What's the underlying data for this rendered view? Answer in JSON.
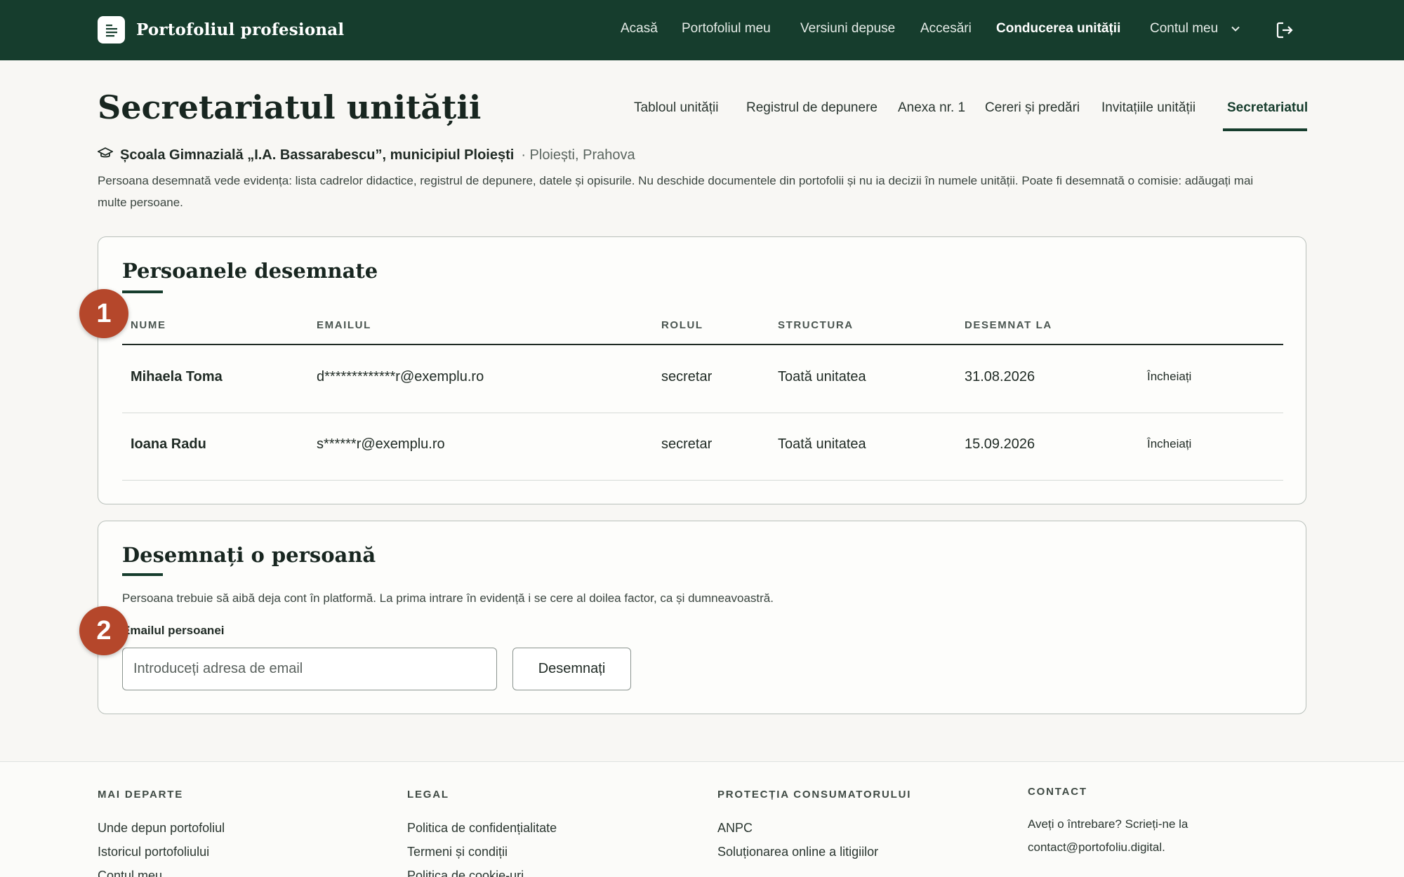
{
  "header": {
    "brand": "Portofoliul profesional",
    "nav": [
      "Acasă",
      "Portofoliul meu",
      "Versiuni depuse",
      "Accesări",
      "Conducerea unității"
    ],
    "account": "Contul meu"
  },
  "page": {
    "title": "Secretariatul unității",
    "tabs": [
      "Tabloul unității",
      "Registrul de depunere",
      "Anexa nr. 1",
      "Cereri și predări",
      "Invitațiile unității",
      "Secretariatul"
    ],
    "active_tab": "Secretariatul",
    "school_name": "Școala Gimnazială „I.A. Bassarabescu”, municipiul Ploiești",
    "school_location": "· Ploiești, Prahova",
    "intro": "Persoana desemnată vede evidența: lista cadrelor didactice, registrul de depunere, datele și opisurile. Nu deschide documentele din portofolii și nu ia decizii în numele unității. Poate fi desemnată o comisie: adăugați mai multe persoane."
  },
  "designated": {
    "title": "Persoanele desemnate",
    "columns": [
      "NUME",
      "EMAILUL",
      "ROLUL",
      "STRUCTURA",
      "DESEMNAT LA"
    ],
    "rows": [
      {
        "name": "Mihaela Toma",
        "email": "d*************r@exemplu.ro",
        "role": "secretar",
        "structure": "Toată unitatea",
        "date": "31.08.2026",
        "action": "Încheiați"
      },
      {
        "name": "Ioana Radu",
        "email": "s******r@exemplu.ro",
        "role": "secretar",
        "structure": "Toată unitatea",
        "date": "15.09.2026",
        "action": "Încheiați"
      }
    ]
  },
  "designate_form": {
    "title": "Desemnați o persoană",
    "note": "Persoana trebuie să aibă deja cont în platformă. La prima intrare în evidență i se cere al doilea factor, ca și dumneavoastră.",
    "label": "Emailul persoanei",
    "placeholder": "Introduceți adresa de email",
    "button": "Desemnați"
  },
  "badges": [
    "1",
    "2"
  ],
  "footer": {
    "col1": {
      "title": "MAI DEPARTE",
      "links": [
        "Unde depun portofoliul",
        "Istoricul portofoliului",
        "Contul meu"
      ]
    },
    "col2": {
      "title": "LEGAL",
      "links": [
        "Politica de confidențialitate",
        "Termeni și condiții",
        "Politica de cookie-uri"
      ]
    },
    "col3": {
      "title": "PROTECȚIA CONSUMATORULUI",
      "links": [
        "ANPC",
        "Soluționarea online a litigiilor"
      ]
    },
    "col4": {
      "title": "CONTACT",
      "line1": "Aveți o întrebare? Scrieți-ne la",
      "email": "contact@portofoliu.digital."
    }
  },
  "colors": {
    "brand": "#163d2d",
    "badge": "#b5472b"
  },
  "icons": [
    "document-icon",
    "chevron-down-icon",
    "logout-icon",
    "graduation-cap-icon"
  ]
}
